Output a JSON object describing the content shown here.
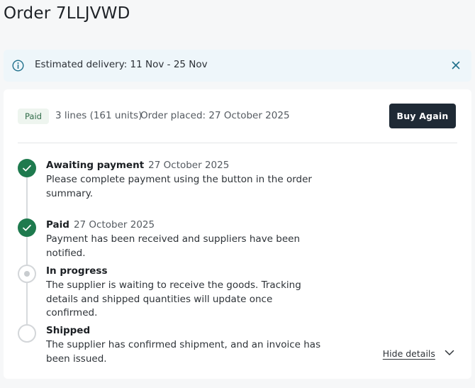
{
  "page": {
    "title": "Order 7LLJVWD"
  },
  "banner": {
    "text": "Estimated delivery: 11 Nov - 25 Nov",
    "icon": "info-icon",
    "close_icon": "close-icon"
  },
  "summary": {
    "status_badge": "Paid",
    "lines": "3 lines (161 units)",
    "order_placed": "Order placed: 27 October 2025",
    "buy_again_label": "Buy Again"
  },
  "timeline": {
    "steps": [
      {
        "title": "Awaiting payment",
        "date": "27 October 2025",
        "description": "Please complete payment using the button in the order summary.",
        "state": "done"
      },
      {
        "title": "Paid",
        "date": "27 October 2025",
        "description": "Payment has been received and suppliers have been notified.",
        "state": "done"
      },
      {
        "title": "In progress",
        "date": "",
        "description": "The supplier is waiting to receive the goods. Tracking details and shipped quantities will update once confirmed.",
        "state": "current"
      },
      {
        "title": "Shipped",
        "date": "",
        "description": "The supplier has confirmed shipment, and an invoice has been issued.",
        "state": "pending"
      }
    ]
  },
  "details_toggle": {
    "label": "Hide details",
    "icon": "chevron-down-icon"
  },
  "colors": {
    "accent_green": "#1e7a4e",
    "button_dark": "#1f2a35",
    "banner_bg": "#eef6fa",
    "info_blue": "#1f6f8b"
  }
}
